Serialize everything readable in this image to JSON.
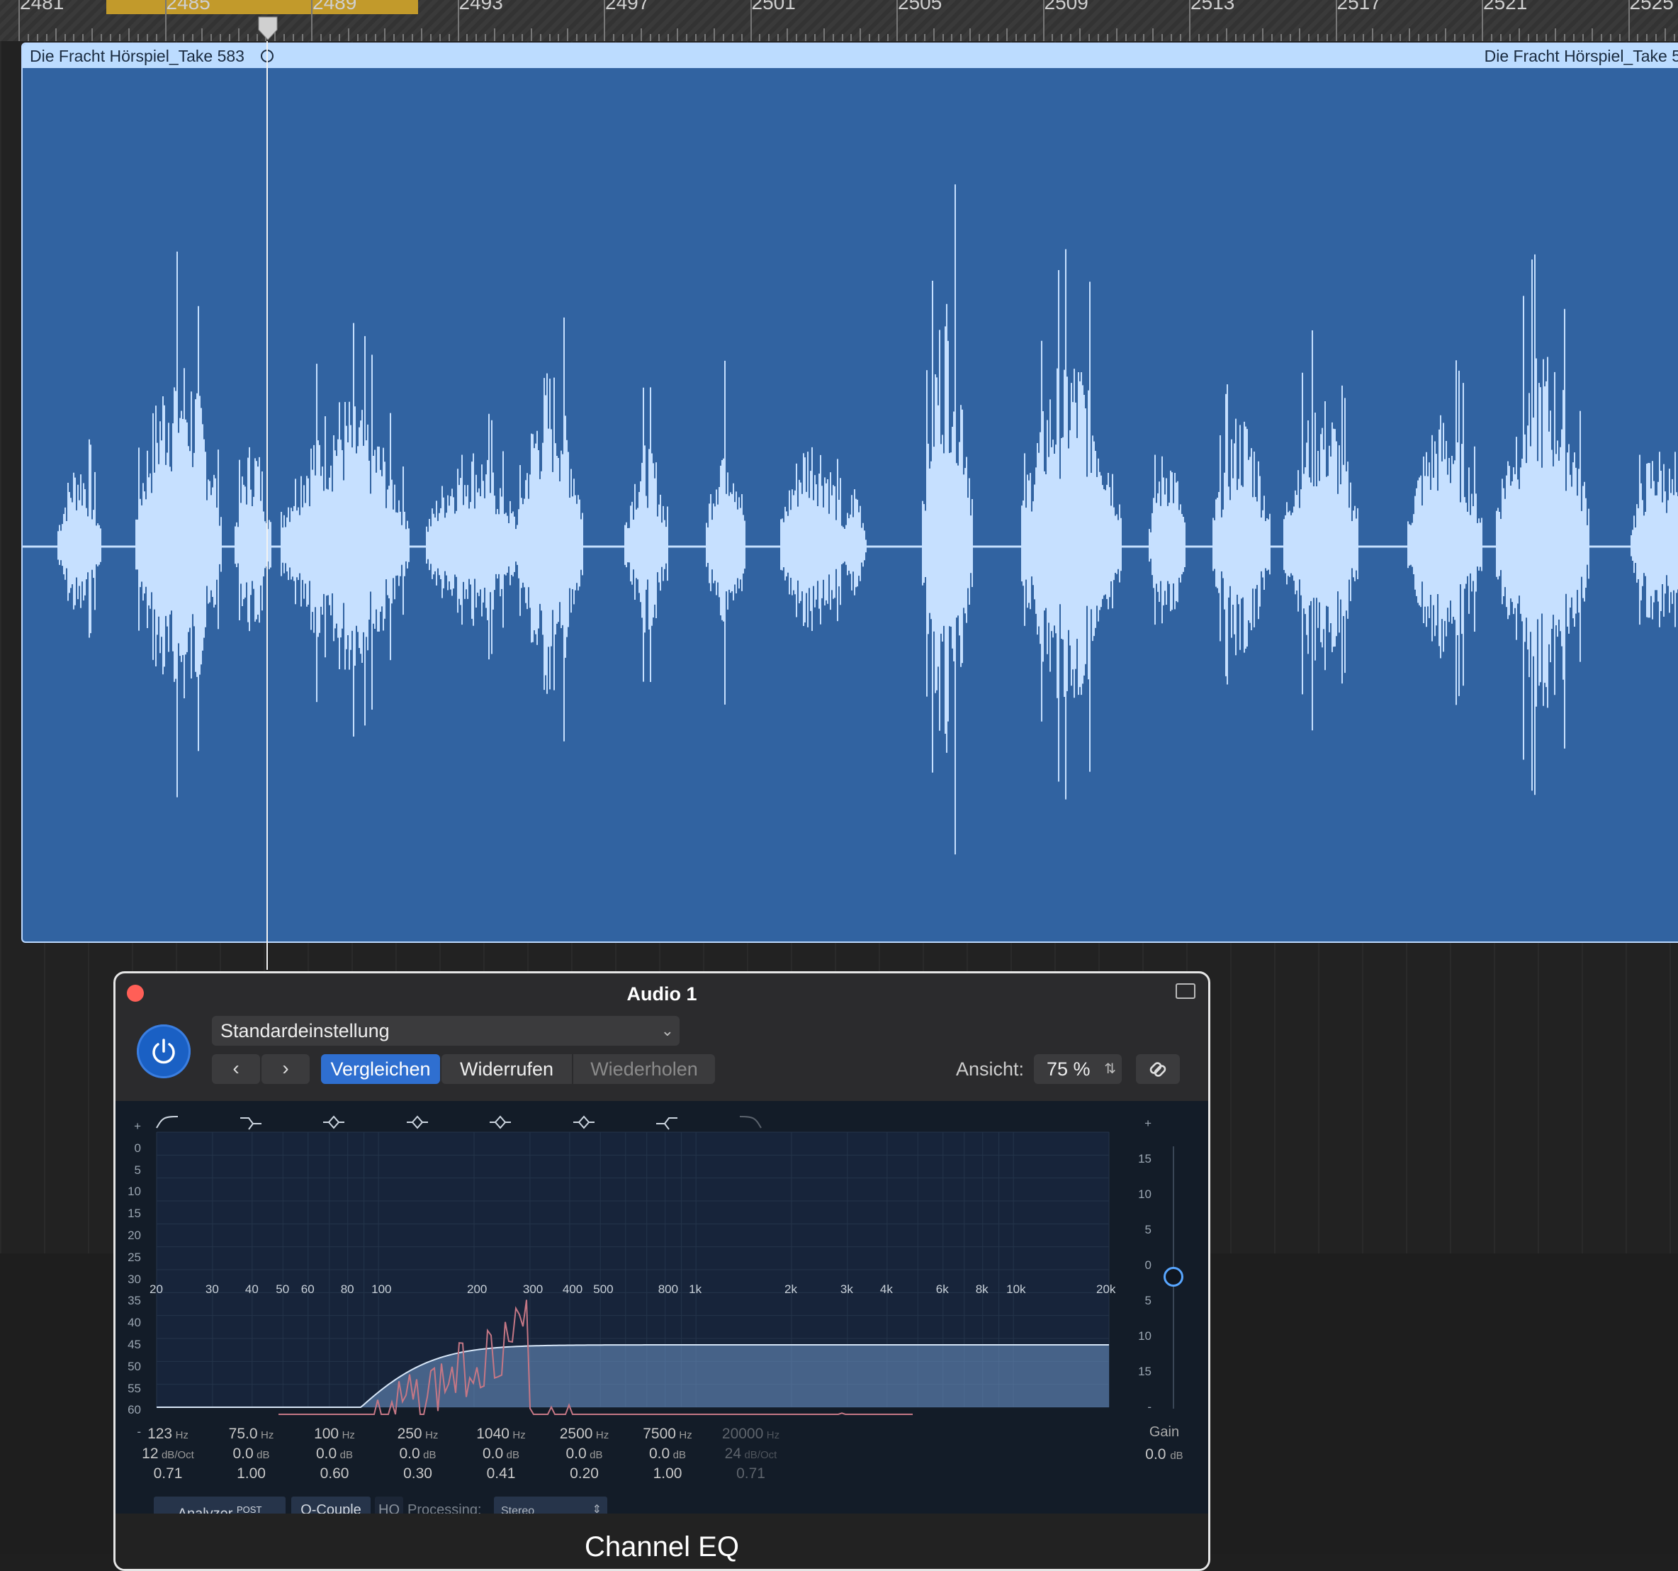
{
  "ruler": {
    "labels": [
      "2481",
      "2485",
      "2489",
      "2493",
      "2497",
      "2501",
      "2505",
      "2509",
      "2513",
      "2517",
      "2521",
      "2525"
    ]
  },
  "region": {
    "name_left": "Die Fracht Hörspiel_Take 583",
    "name_right": "Die Fracht Hörspiel_Take 5",
    "color": "#3163a1",
    "waveform_color": "#c6e0ff"
  },
  "plugin": {
    "title": "Audio 1",
    "preset": "Standardeinstellung",
    "prev_icon": "chevron-left-icon",
    "next_icon": "chevron-right-icon",
    "compare_label": "Vergleichen",
    "undo_label": "Widerrufen",
    "redo_label": "Wiederholen",
    "view_label": "Ansicht:",
    "view_value": "75 %",
    "link_icon": "link-icon",
    "accent": "#2f6fd0",
    "eq": {
      "scale_left": [
        "+",
        "0",
        "5",
        "10",
        "15",
        "20",
        "25",
        "30",
        "35",
        "40",
        "45",
        "50",
        "55",
        "60",
        "-"
      ],
      "scale_right": [
        "+",
        "15",
        "10",
        "5",
        "0",
        "5",
        "10",
        "15",
        "-"
      ],
      "freq_labels": [
        "20",
        "30",
        "40",
        "50",
        "60",
        "80",
        "100",
        "200",
        "300",
        "400",
        "500",
        "800",
        "1k",
        "2k",
        "3k",
        "4k",
        "6k",
        "8k",
        "10k",
        "20k"
      ],
      "bands": [
        {
          "type": "low-cut-icon",
          "freq": "123",
          "freq_unit": "Hz",
          "gain": "12",
          "gain_unit": "dB/Oct",
          "q": "0.71",
          "enabled": true
        },
        {
          "type": "low-shelf-icon",
          "freq": "75.0",
          "freq_unit": "Hz",
          "gain": "0.0",
          "gain_unit": "dB",
          "q": "1.00",
          "enabled": true
        },
        {
          "type": "bell-icon",
          "freq": "100",
          "freq_unit": "Hz",
          "gain": "0.0",
          "gain_unit": "dB",
          "q": "0.60",
          "enabled": true
        },
        {
          "type": "bell-icon",
          "freq": "250",
          "freq_unit": "Hz",
          "gain": "0.0",
          "gain_unit": "dB",
          "q": "0.30",
          "enabled": true
        },
        {
          "type": "bell-icon",
          "freq": "1040",
          "freq_unit": "Hz",
          "gain": "0.0",
          "gain_unit": "dB",
          "q": "0.41",
          "enabled": true
        },
        {
          "type": "bell-icon",
          "freq": "2500",
          "freq_unit": "Hz",
          "gain": "0.0",
          "gain_unit": "dB",
          "q": "0.20",
          "enabled": true
        },
        {
          "type": "high-shelf-icon",
          "freq": "7500",
          "freq_unit": "Hz",
          "gain": "0.0",
          "gain_unit": "dB",
          "q": "1.00",
          "enabled": true
        },
        {
          "type": "high-cut-icon",
          "freq": "20000",
          "freq_unit": "Hz",
          "gain": "24",
          "gain_unit": "dB/Oct",
          "q": "0.71",
          "enabled": false
        }
      ],
      "gain_label": "Gain",
      "gain_value": "0.0",
      "gain_unit": "dB"
    },
    "footer": {
      "analyzer_label": "Analyzer",
      "analyzer_sup": "POST",
      "qcouple_label": "Q-Couple",
      "hq_label": "HQ",
      "processing_label": "Processing:",
      "processing_value": "Stereo"
    },
    "plugin_name": "Channel EQ"
  }
}
